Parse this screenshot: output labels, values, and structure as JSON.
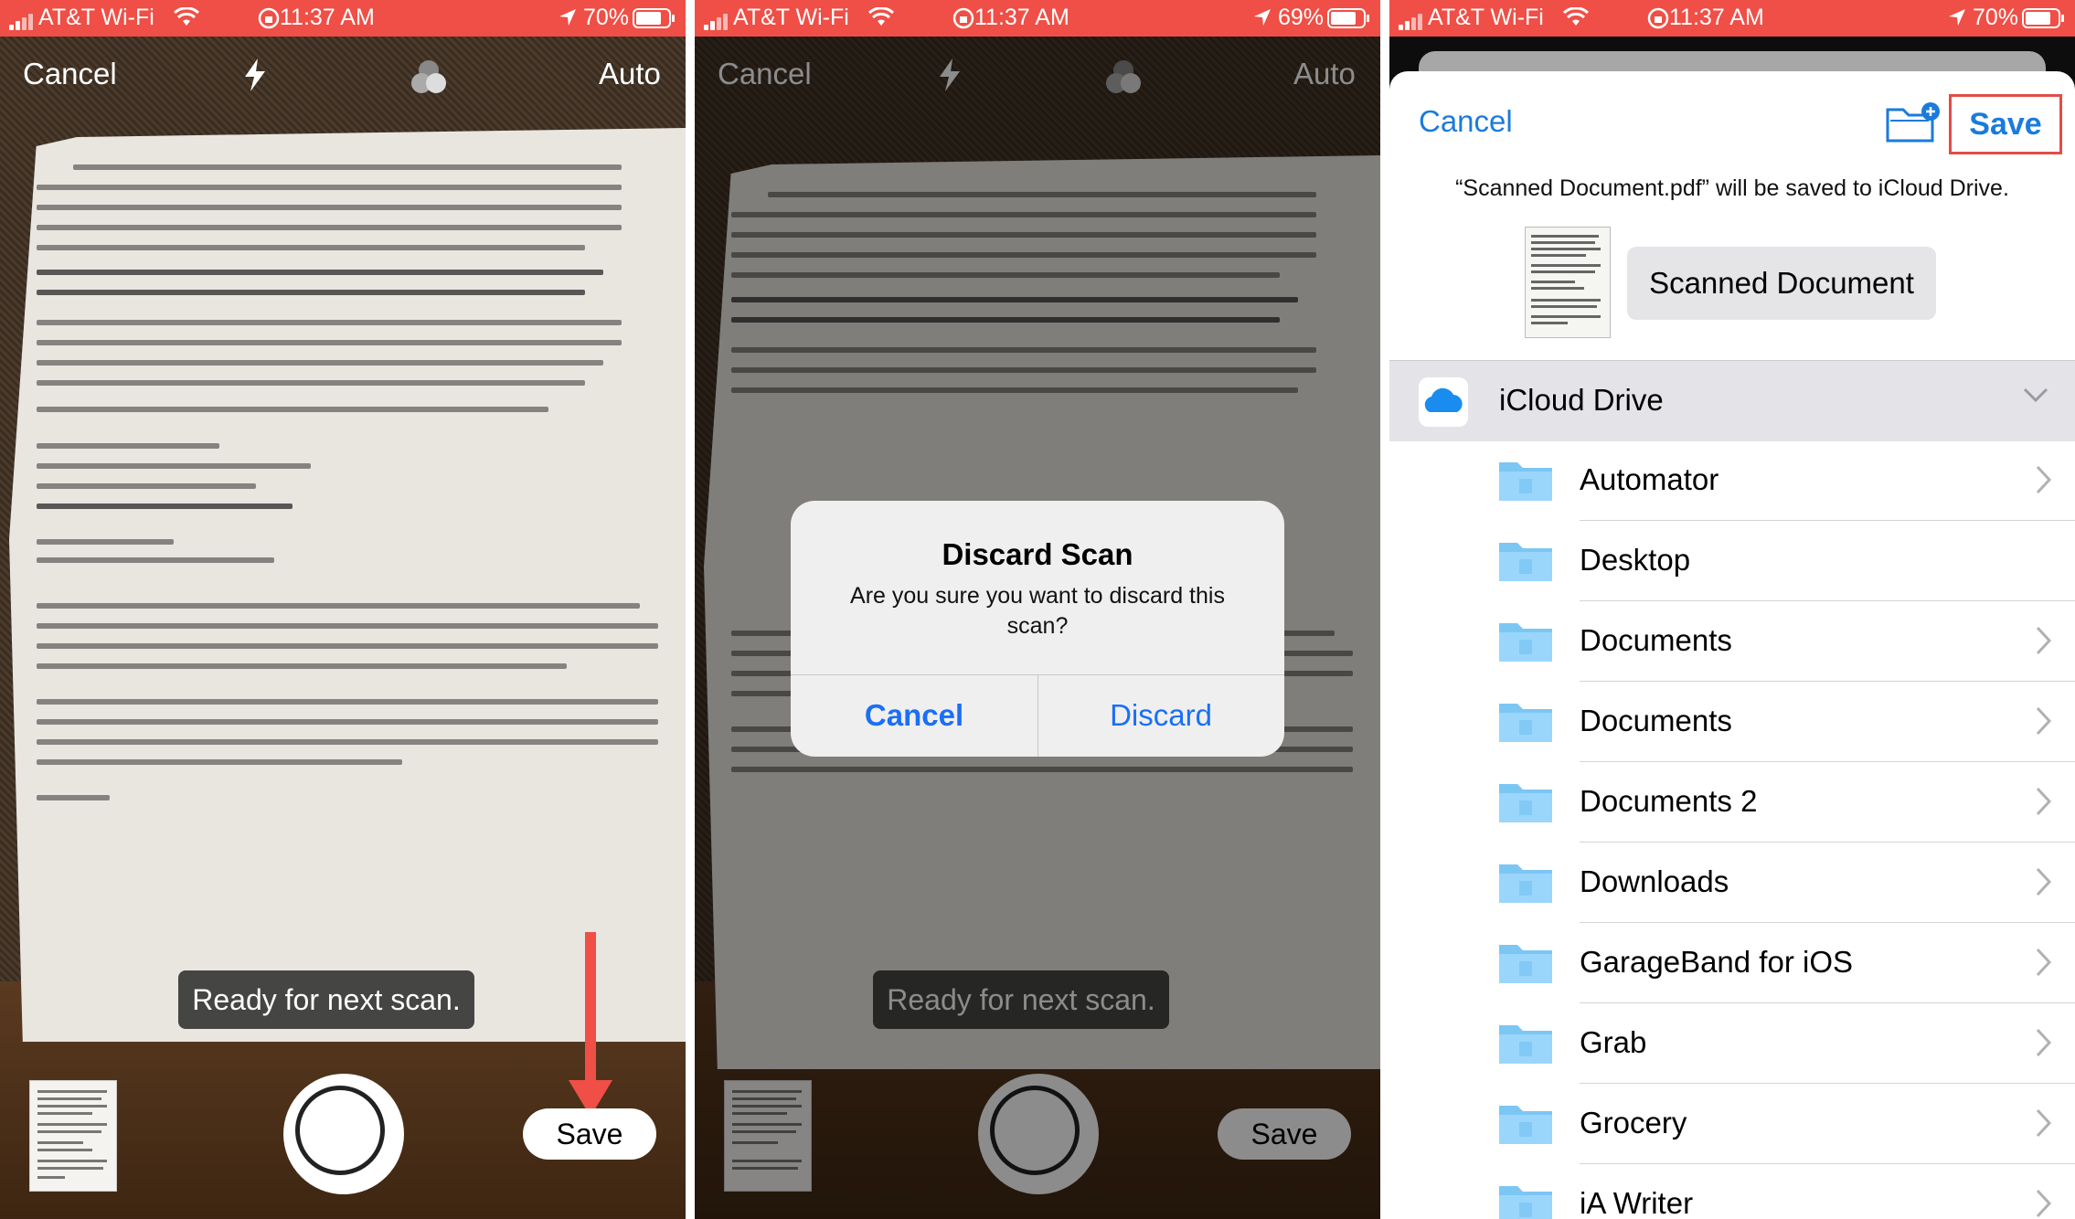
{
  "status": {
    "carrier": "AT&T Wi-Fi",
    "time": "11:37 AM",
    "battery_left": "70%",
    "battery_middle": "69%",
    "battery_right": "70%"
  },
  "camera": {
    "cancel": "Cancel",
    "mode": "Auto",
    "ready_toast": "Ready for next scan.",
    "save": "Save",
    "flash_icon": "flash-icon",
    "filter_icon": "color-filter-icon"
  },
  "alert": {
    "title": "Discard Scan",
    "message": "Are you sure you want to discard this scan?",
    "cancel": "Cancel",
    "discard": "Discard"
  },
  "save_sheet": {
    "cancel": "Cancel",
    "save": "Save",
    "info": "“Scanned Document.pdf” will be saved to iCloud Drive.",
    "filename": "Scanned Document",
    "location": "iCloud Drive",
    "folders": [
      {
        "label": "Automator",
        "chevron": true
      },
      {
        "label": "Desktop",
        "chevron": false
      },
      {
        "label": "Documents",
        "chevron": true
      },
      {
        "label": "Documents",
        "chevron": true
      },
      {
        "label": "Documents 2",
        "chevron": true
      },
      {
        "label": "Downloads",
        "chevron": true
      },
      {
        "label": "GarageBand for iOS",
        "chevron": true
      },
      {
        "label": "Grab",
        "chevron": true
      },
      {
        "label": "Grocery",
        "chevron": true
      },
      {
        "label": "iA Writer",
        "chevron": true
      }
    ]
  },
  "colors": {
    "status_red": "#ef4f46",
    "ios_blue": "#1a7bdc",
    "highlight_red": "#e54b47"
  }
}
